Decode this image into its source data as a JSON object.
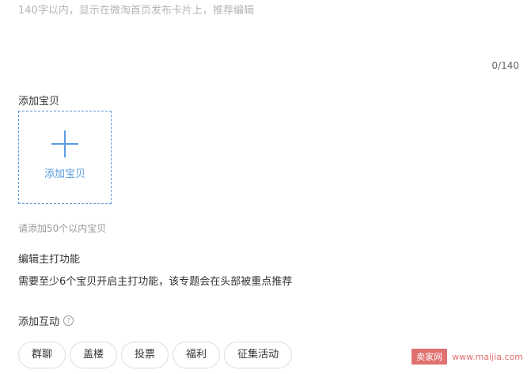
{
  "description_placeholder": "140字以内，显示在微淘首页发布卡片上，推荐编辑",
  "char_counter": "0/140",
  "add_item": {
    "label": "添加宝贝",
    "button_text": "添加宝贝",
    "hint": "请添加50个以内宝贝"
  },
  "feature": {
    "label": "编辑主打功能",
    "description": "需要至少6个宝贝开启主打功能，该专题会在头部被重点推荐"
  },
  "interaction": {
    "label": "添加互动",
    "help_icon": "?",
    "tags": [
      "群聊",
      "盖楼",
      "投票",
      "福利",
      "征集活动"
    ]
  },
  "watermark": {
    "badge": "卖家网",
    "url": "www.maijia.com"
  },
  "colors": {
    "accent": "#5b9bde",
    "watermark": "#e0716f"
  }
}
